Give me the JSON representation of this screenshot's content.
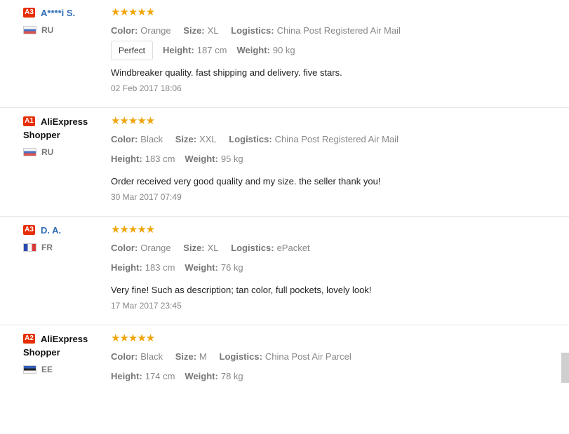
{
  "reviews": [
    {
      "badge": "A3",
      "name": "A****i S.",
      "country": "RU",
      "flag": "ru",
      "name_link": true,
      "stars": "★★★★★",
      "color_label": "Color:",
      "color": "Orange",
      "size_label": "Size:",
      "size": "XL",
      "logistics_label": "Logistics:",
      "logistics": "China Post Registered Air Mail",
      "tag": "Perfect",
      "height_label": "Height:",
      "height": "187 cm",
      "weight_label": "Weight:",
      "weight": "90 kg",
      "text": "Windbreaker quality. fast shipping and delivery. five stars.",
      "date": "02 Feb 2017 18:06"
    },
    {
      "badge": "A1",
      "name": "AliExpress Shopper",
      "country": "RU",
      "flag": "ru",
      "name_link": false,
      "stars": "★★★★★",
      "color_label": "Color:",
      "color": "Black",
      "size_label": "Size:",
      "size": "XXL",
      "logistics_label": "Logistics:",
      "logistics": "China Post Registered Air Mail",
      "tag": "",
      "height_label": "Height:",
      "height": "183 cm",
      "weight_label": "Weight:",
      "weight": "95 kg",
      "text": "Order received very good quality and my size. the seller thank you!",
      "date": "30 Mar 2017 07:49"
    },
    {
      "badge": "A3",
      "name": "D. A.",
      "country": "FR",
      "flag": "fr",
      "name_link": true,
      "stars": "★★★★★",
      "color_label": "Color:",
      "color": "Orange",
      "size_label": "Size:",
      "size": "XL",
      "logistics_label": "Logistics:",
      "logistics": "ePacket",
      "tag": "",
      "height_label": "Height:",
      "height": "183 cm",
      "weight_label": "Weight:",
      "weight": "76 kg",
      "text": "Very fine! Such as description; tan color, full pockets, lovely look!",
      "date": "17 Mar 2017 23:45"
    },
    {
      "badge": "A2",
      "name": "AliExpress Shopper",
      "country": "EE",
      "flag": "ee",
      "name_link": false,
      "stars": "★★★★★",
      "color_label": "Color:",
      "color": "Black",
      "size_label": "Size:",
      "size": "M",
      "logistics_label": "Logistics:",
      "logistics": "China Post Air Parcel",
      "tag": "",
      "height_label": "Height:",
      "height": "174 cm",
      "weight_label": "Weight:",
      "weight": "78 kg",
      "text": "",
      "date": ""
    }
  ],
  "rating_value": "5 of 5 stars"
}
